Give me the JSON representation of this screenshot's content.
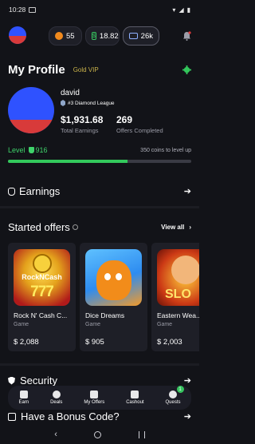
{
  "status_bar": {
    "time": "10:28"
  },
  "topbar": {
    "fire_count": "55",
    "cash_balance": "18.82",
    "ticket_count": "26k"
  },
  "profile": {
    "title": "My Profile",
    "vip_label": "Gold VIP",
    "username": "david",
    "league": "#3 Diamond League",
    "total_earnings_value": "$1,931.68",
    "total_earnings_label": "Total Earnings",
    "offers_completed_value": "269",
    "offers_completed_label": "Offers Completed",
    "level_label": "Level",
    "level_value": "916",
    "level_hint": "350 coins to level up",
    "level_progress_fraction": 0.65
  },
  "sections": {
    "earnings": "Earnings",
    "started_offers": "Started offers",
    "view_all": "View all",
    "security": "Security",
    "bonus_code": "Have a Bonus Code?"
  },
  "offers": [
    {
      "name": "Rock N' Cash C...",
      "type": "Game",
      "price": "$ 2,088",
      "logo_text": "RockNCash",
      "logo_number": "777"
    },
    {
      "name": "Dice Dreams",
      "type": "Game",
      "price": "$ 905"
    },
    {
      "name": "Eastern Wea...",
      "type": "Game",
      "price": "$ 2,003",
      "logo_text": "SLO"
    }
  ],
  "bottom_nav": {
    "earn": "Earn",
    "deals": "Deals",
    "my_offers": "My Offers",
    "cashout": "Cashout",
    "quests": "Quests",
    "quests_badge": "1"
  },
  "colors": {
    "background": "#121318",
    "accent_green": "#33c95c",
    "vip_gold": "#c9b24a"
  }
}
